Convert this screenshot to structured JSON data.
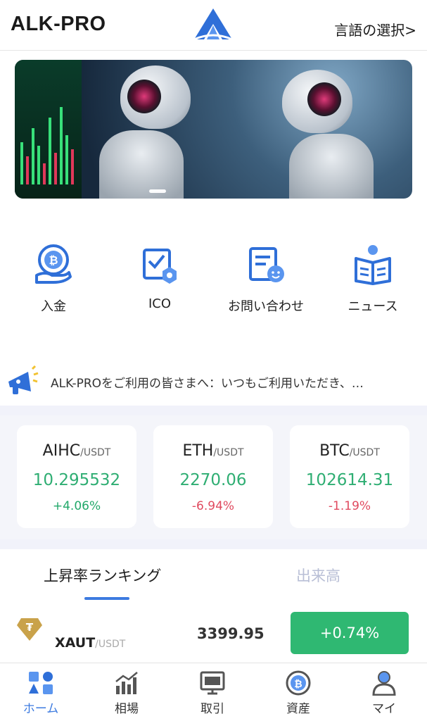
{
  "header": {
    "brand": "ALK-PRO",
    "language_button": "言語の選択>"
  },
  "banner": {
    "slide_count_indicator": "active"
  },
  "quick_menu": [
    {
      "label": "入金",
      "icon": "bitcoin-deposit-icon"
    },
    {
      "label": "ICO",
      "icon": "checklist-gear-icon"
    },
    {
      "label": "お問い合わせ",
      "icon": "contact-support-icon"
    },
    {
      "label": "ニュース",
      "icon": "news-reader-icon"
    }
  ],
  "notice": {
    "icon": "megaphone-icon",
    "text": "ALK-PROをご利用の皆さまへ：いつもご利用いただき、…"
  },
  "market_cards": [
    {
      "base": "AIHC",
      "quote": "/USDT",
      "price": "10.295532",
      "change": "+4.06%",
      "direction": "up"
    },
    {
      "base": "ETH",
      "quote": "/USDT",
      "price": "2270.06",
      "change": "-6.94%",
      "direction": "down"
    },
    {
      "base": "BTC",
      "quote": "/USDT",
      "price": "102614.31",
      "change": "-1.19%",
      "direction": "down"
    }
  ],
  "ranking": {
    "tabs": [
      {
        "label": "上昇率ランキング",
        "active": true
      },
      {
        "label": "出来高",
        "active": false
      }
    ],
    "rows": [
      {
        "base": "XAUT",
        "quote": "/USDT",
        "price": "3399.95",
        "change": "+0.74%",
        "icon": "tether-gold-icon"
      }
    ]
  },
  "nav": [
    {
      "label": "ホーム",
      "icon": "home-grid-icon",
      "active": true
    },
    {
      "label": "相場",
      "icon": "market-chart-icon",
      "active": false
    },
    {
      "label": "取引",
      "icon": "trade-monitor-icon",
      "active": false
    },
    {
      "label": "資産",
      "icon": "bitcoin-asset-icon",
      "active": false
    },
    {
      "label": "マイ",
      "icon": "user-profile-icon",
      "active": false
    }
  ],
  "colors": {
    "accent": "#3d7be0",
    "up": "#22a86a",
    "down": "#e04a5f",
    "up_button": "#2fb872"
  }
}
